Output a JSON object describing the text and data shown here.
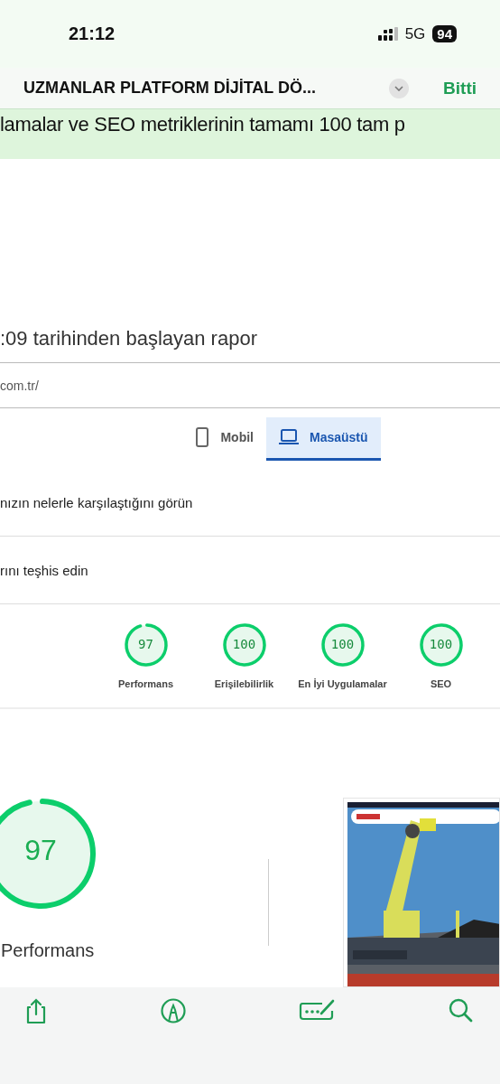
{
  "status_bar": {
    "time": "21:12",
    "network": "5G",
    "battery": "94"
  },
  "header": {
    "title": "UZMANLAR PLATFORM DİJİTAL DÖ...",
    "done": "Bitti"
  },
  "banner": {
    "text": "lamalar ve SEO metriklerinin tamamı 100 tam p"
  },
  "report": {
    "heading": ":09 tarihinden başlayan rapor",
    "url": "com.tr/"
  },
  "tabs": [
    {
      "label": "Mobil",
      "kind": "phone",
      "selected": false
    },
    {
      "label": "Masaüstü",
      "kind": "laptop",
      "selected": true
    }
  ],
  "sections": [
    "nızın nelerle karşılaştığını görün",
    "rını teşhis edin"
  ],
  "scores": [
    {
      "value": "97",
      "label": "Performans"
    },
    {
      "value": "100",
      "label": "Erişilebilirlik"
    },
    {
      "value": "100",
      "label": "En İyi Uygulamalar"
    },
    {
      "value": "100",
      "label": "SEO"
    }
  ],
  "main_score": {
    "value": "97",
    "label": "Performans"
  },
  "toolbar": [
    {
      "kind": "share"
    },
    {
      "kind": "markup"
    },
    {
      "kind": "signature"
    },
    {
      "kind": "search"
    }
  ]
}
